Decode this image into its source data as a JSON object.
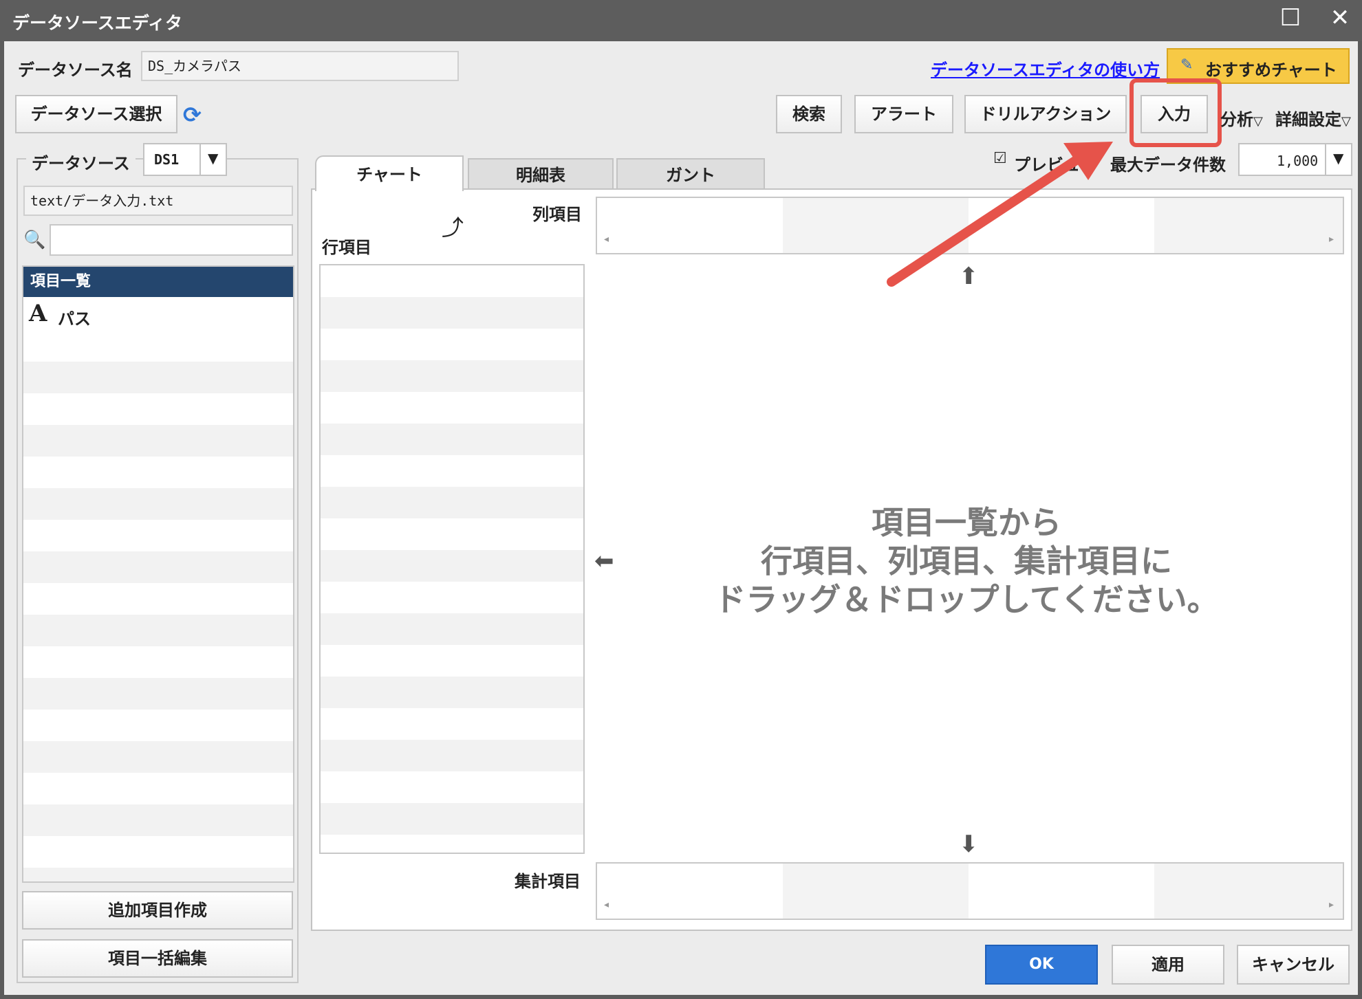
{
  "window": {
    "title": "データソースエディタ",
    "maximize_icon": "☐",
    "close_icon": "✕"
  },
  "header": {
    "datasource_name_label": "データソース名",
    "datasource_name_value": "DS_カメラパス",
    "help_link": "データソースエディタの使い方",
    "recommend_button": "おすすめチャート",
    "recommend_icon": "pin-icon"
  },
  "toolbar": {
    "select_datasource": "データソース選択",
    "refresh_icon": "⟳",
    "search": "検索",
    "alert": "アラート",
    "drill_action": "ドリルアクション",
    "input": "入力",
    "analysis": "分析",
    "detail_settings": "詳細設定",
    "dropdown_glyph": "▽"
  },
  "left_panel": {
    "datasource_label": "データソース",
    "datasource_select": "DS1",
    "file_path": "text/データ入力.txt",
    "search_icon": "🔍",
    "search_placeholder": "",
    "list_header": "項目一覧",
    "items": [
      {
        "icon": "A",
        "label": "パス"
      }
    ],
    "add_item_button": "追加項目作成",
    "bulk_edit_button": "項目一括編集"
  },
  "tabs": [
    {
      "label": "チャート",
      "active": true
    },
    {
      "label": "明細表",
      "active": false
    },
    {
      "label": "ガント",
      "active": false
    }
  ],
  "preview": {
    "checkbox_mark": "☑",
    "label": "プレビュー",
    "max_rows_label": "最大データ件数",
    "max_rows_value": "1,000"
  },
  "chart_area": {
    "column_items_label": "列項目",
    "row_items_label": "行項目",
    "aggregate_items_label": "集計項目",
    "swap_icon": "⤴",
    "placeholder_lines": [
      "項目一覧から",
      "行項目、列項目、集計項目に",
      "ドラッグ＆ドロップしてください。"
    ],
    "up_arrow": "⬆",
    "down_arrow": "⬇",
    "left_arrow": "⬅",
    "scroll_left": "◂",
    "scroll_right": "▸"
  },
  "footer": {
    "ok": "OK",
    "apply": "適用",
    "cancel": "キャンセル"
  },
  "colors": {
    "accent": "#2f77d8",
    "list_header_bg": "#24466e",
    "highlight": "#e6534a",
    "recommend_bg": "#f7c945"
  }
}
